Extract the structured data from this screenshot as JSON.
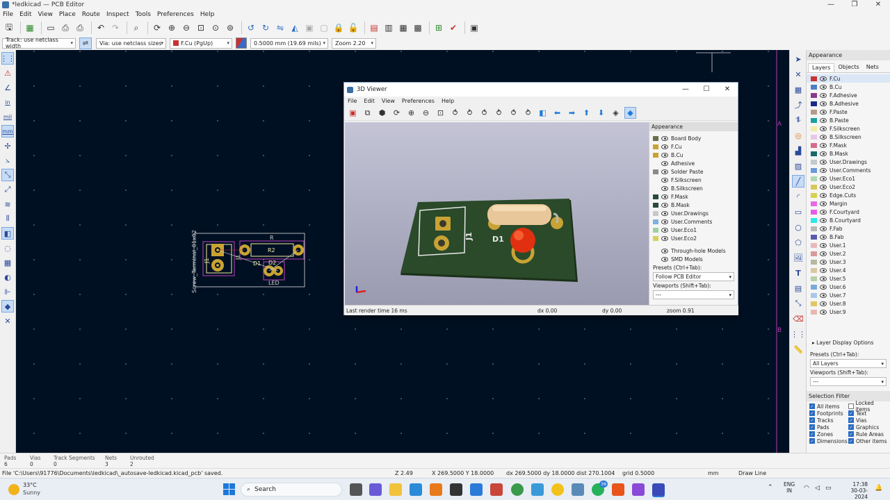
{
  "window": {
    "title": "*ledkicad — PCB Editor",
    "controls": [
      "—",
      "❐",
      "✕"
    ]
  },
  "menu": [
    "File",
    "Edit",
    "View",
    "Place",
    "Route",
    "Inspect",
    "Tools",
    "Preferences",
    "Help"
  ],
  "toolbar2": {
    "track": "Track: use netclass width",
    "via": "Via: use netclass sizes",
    "layer": "F.Cu (PgUp)",
    "layer_color": "#c83232",
    "grid": "0.5000 mm (19.69 mils)",
    "zoom": "Zoom 2.20"
  },
  "left_toolbar_labels": {
    "in": "in",
    "mil": "mil",
    "mm": "mm"
  },
  "canvas": {
    "board": {
      "silkscreen_conn": "Screw_Terminal_01x02",
      "j1": "J1",
      "j1b": "J1",
      "r": "R",
      "r2": "R2",
      "d1": "D1",
      "d2": "D2",
      "led": "LED"
    },
    "markers": {
      "a": "A",
      "b": "B"
    }
  },
  "viewer": {
    "title": "3D Viewer",
    "menu": [
      "File",
      "Edit",
      "View",
      "Preferences",
      "Help"
    ],
    "board_labels": {
      "j1": "J1",
      "d1": "D1"
    },
    "appearance": {
      "title": "Appearance",
      "layers": [
        {
          "name": "Board Body",
          "color": "#6b6e4c",
          "eye": true
        },
        {
          "name": "F.Cu",
          "color": "#c8a334",
          "eye": true
        },
        {
          "name": "B.Cu",
          "color": "#c8a334",
          "eye": true
        },
        {
          "name": "Adhesive",
          "color": "",
          "eye": true
        },
        {
          "name": "Solder Paste",
          "color": "#8a8a8a",
          "eye": true
        },
        {
          "name": "F.Silkscreen",
          "color": "",
          "eye": true
        },
        {
          "name": "B.Silkscreen",
          "color": "",
          "eye": true
        },
        {
          "name": "F.Mask",
          "color": "#2b4a3a",
          "eye": true
        },
        {
          "name": "B.Mask",
          "color": "#2b4a3a",
          "eye": true
        },
        {
          "name": "User.Drawings",
          "color": "#c8c8c8",
          "eye": true
        },
        {
          "name": "User.Comments",
          "color": "#7fb0e0",
          "eye": true
        },
        {
          "name": "User.Eco1",
          "color": "#9fd0a0",
          "eye": true
        },
        {
          "name": "User.Eco2",
          "color": "#d8d05a",
          "eye": true
        }
      ],
      "models": [
        "Through-hole Models",
        "SMD Models"
      ],
      "presets_label": "Presets (Ctrl+Tab):",
      "presets_value": "Follow PCB Editor",
      "viewports_label": "Viewports (Shift+Tab):",
      "viewports_value": "---"
    },
    "status": {
      "render": "Last render time 16 ms",
      "dx": "dx 0.00",
      "dy": "dy 0.00",
      "zoom": "zoom 0.91"
    }
  },
  "appearance_panel": {
    "title": "Appearance",
    "tabs": [
      "Layers",
      "Objects",
      "Nets"
    ],
    "layers": [
      {
        "name": "F.Cu",
        "color": "#c83232"
      },
      {
        "name": "B.Cu",
        "color": "#4d7fc4"
      },
      {
        "name": "F.Adhesive",
        "color": "#8a3a8a"
      },
      {
        "name": "B.Adhesive",
        "color": "#1a2a8a"
      },
      {
        "name": "F.Paste",
        "color": "#b49a8a"
      },
      {
        "name": "B.Paste",
        "color": "#1aa0a0"
      },
      {
        "name": "F.Silkscreen",
        "color": "#f2eda1"
      },
      {
        "name": "B.Silkscreen",
        "color": "#e6c8e6"
      },
      {
        "name": "F.Mask",
        "color": "#d86a8a"
      },
      {
        "name": "B.Mask",
        "color": "#1a6a6a"
      },
      {
        "name": "User.Drawings",
        "color": "#c2c8ce"
      },
      {
        "name": "User.Comments",
        "color": "#6a9ad8"
      },
      {
        "name": "User.Eco1",
        "color": "#b0d8b0"
      },
      {
        "name": "User.Eco2",
        "color": "#d8c85a"
      },
      {
        "name": "Edge.Cuts",
        "color": "#d8d050"
      },
      {
        "name": "Margin",
        "color": "#e86ae8"
      },
      {
        "name": "F.Courtyard",
        "color": "#e85ae8"
      },
      {
        "name": "B.Courtyard",
        "color": "#2ae8e8"
      },
      {
        "name": "F.Fab",
        "color": "#b8b8b8"
      },
      {
        "name": "B.Fab",
        "color": "#5a5ab0"
      },
      {
        "name": "User.1",
        "color": "#e8b8b8"
      },
      {
        "name": "User.2",
        "color": "#d89a9a"
      },
      {
        "name": "User.3",
        "color": "#b8b8a0"
      },
      {
        "name": "User.4",
        "color": "#d8c8a0"
      },
      {
        "name": "User.5",
        "color": "#b8d0a8"
      },
      {
        "name": "User.6",
        "color": "#7aaad8"
      },
      {
        "name": "User.7",
        "color": "#a8c8e8"
      },
      {
        "name": "User.8",
        "color": "#e0c860"
      },
      {
        "name": "User.9",
        "color": "#e8b8b0"
      }
    ],
    "layer_display_options": "Layer Display Options",
    "presets_label": "Presets (Ctrl+Tab):",
    "presets_value": "All Layers",
    "viewports_label": "Viewports (Shift+Tab):",
    "viewports_value": "---"
  },
  "selection_filter": {
    "title": "Selection Filter",
    "items": [
      {
        "label": "All items",
        "checked": true
      },
      {
        "label": "Locked items",
        "checked": false
      },
      {
        "label": "Footprints",
        "checked": true
      },
      {
        "label": "Text",
        "checked": true
      },
      {
        "label": "Tracks",
        "checked": true
      },
      {
        "label": "Vias",
        "checked": true
      },
      {
        "label": "Pads",
        "checked": true
      },
      {
        "label": "Graphics",
        "checked": true
      },
      {
        "label": "Zones",
        "checked": true
      },
      {
        "label": "Rule Areas",
        "checked": true
      },
      {
        "label": "Dimensions",
        "checked": true
      },
      {
        "label": "Other items",
        "checked": true
      }
    ]
  },
  "stats": [
    {
      "label": "Pads",
      "value": "6"
    },
    {
      "label": "Vias",
      "value": "0"
    },
    {
      "label": "Track Segments",
      "value": "0"
    },
    {
      "label": "Nets",
      "value": "3"
    },
    {
      "label": "Unrouted",
      "value": "2"
    }
  ],
  "status": {
    "message": "File 'C:\\Users\\91776\\Documents\\ledkicad\\_autosave-ledkicad.kicad_pcb' saved.",
    "z": "Z 2.49",
    "xy": "X 269.5000  Y 18.0000",
    "dxy": "dx 269.5000  dy 18.0000  dist 270.1004",
    "grid": "grid 0.5000",
    "units": "mm",
    "tool": "Draw Line"
  },
  "taskbar": {
    "weather_temp": "33°C",
    "weather_desc": "Sunny",
    "search": "Search",
    "lang1": "ENG",
    "lang2": "IN",
    "time": "17:38",
    "date": "30-03-2024",
    "badge": "36"
  }
}
